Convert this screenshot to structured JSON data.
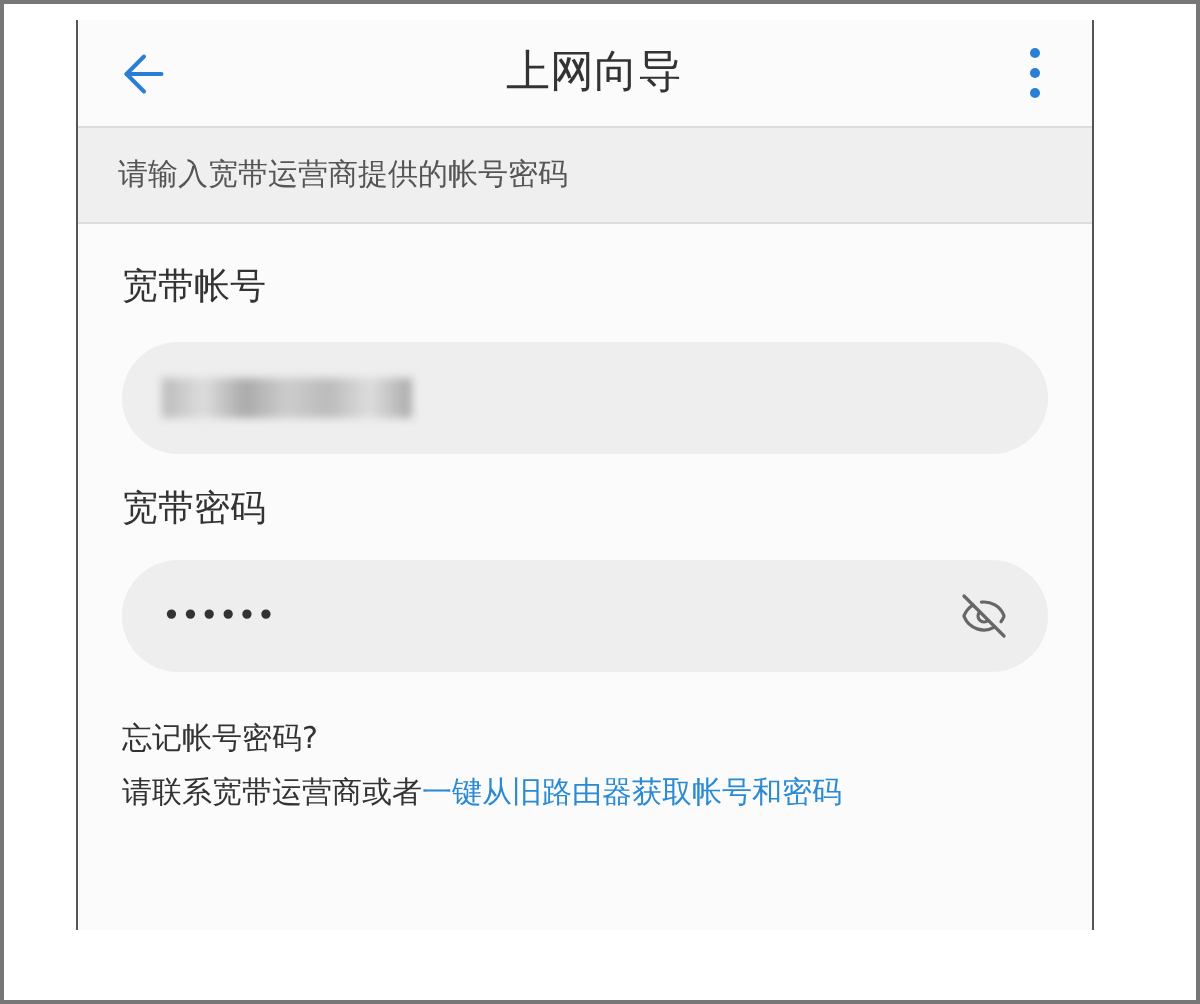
{
  "header": {
    "title": "上网向导"
  },
  "notice": "请输入宽带运营商提供的帐号密码",
  "account": {
    "label": "宽带帐号"
  },
  "password": {
    "label": "宽带密码",
    "value": "••••••",
    "visible": false
  },
  "help": {
    "title": "忘记帐号密码?",
    "prompt": "请联系宽带运营商或者",
    "link": "一键从旧路由器获取帐号和密码"
  }
}
